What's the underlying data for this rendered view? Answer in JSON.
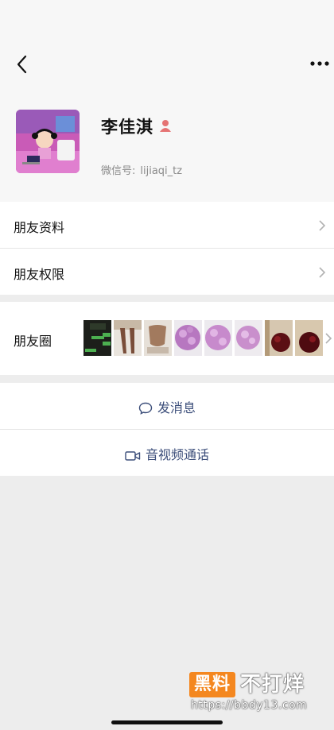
{
  "nav": {
    "back_icon": "chevron-left-icon",
    "more_icon": "more-horizontal-icon"
  },
  "profile": {
    "name": "李佳淇",
    "wechat_id_label": "微信号:",
    "wechat_id": "lijiaqi_tz",
    "gender_icon": "female-icon"
  },
  "menu": [
    {
      "label": "朋友资料"
    },
    {
      "label": "朋友权限"
    }
  ],
  "moments": {
    "label": "朋友圈",
    "thumbnail_count": 8
  },
  "actions": {
    "message": "发消息",
    "video_call": "音视频通话"
  },
  "watermark": {
    "badge": "黑料",
    "text": "不打烊",
    "url": "https://bbdy13.com"
  },
  "colors": {
    "link_blue": "#3c4e7a",
    "background": "#ededed",
    "female_icon": "#e57373",
    "watermark_orange": "#f4871f"
  }
}
